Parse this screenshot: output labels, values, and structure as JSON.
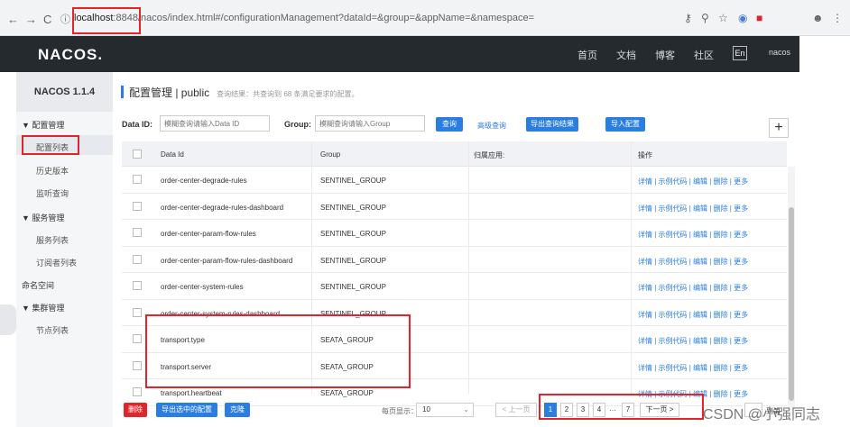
{
  "browser": {
    "back": "←",
    "forward": "→",
    "reload": "C",
    "url_host": "localhost",
    "url_port": ":8848",
    "url_path": "/nacos/index.html#/configurationManagement?dataId=&group=&appName=&namespace="
  },
  "header": {
    "logo": "NACOS.",
    "menu": [
      "首页",
      "文档",
      "博客",
      "社区"
    ],
    "lang": "En",
    "user": "nacos"
  },
  "sidebar": {
    "version": "NACOS 1.1.4",
    "groups": [
      {
        "label": "▼ 配置管理",
        "items": [
          "配置列表",
          "历史版本",
          "监听查询"
        ]
      },
      {
        "label": "▼ 服务管理",
        "items": [
          "服务列表",
          "订阅者列表"
        ]
      },
      {
        "label": "命名空间",
        "items": []
      },
      {
        "label": "▼ 集群管理",
        "items": [
          "节点列表"
        ]
      }
    ]
  },
  "main": {
    "breadcrumb": "配置管理 | public",
    "subtitle": "查询结果：共查询到 68 条满足要求的配置。",
    "filter": {
      "dataid_label": "Data ID:",
      "dataid_placeholder": "模糊查询请输入Data ID",
      "group_label": "Group:",
      "group_placeholder": "模糊查询请输入Group",
      "query": "查询",
      "advanced": "高级查询",
      "export_query": "导出查询结果",
      "import": "导入配置",
      "add": "+"
    },
    "table": {
      "headers": [
        "Data Id",
        "Group",
        "归属应用:",
        "操作"
      ],
      "ops": "详情 | 示例代码 | 编辑 | 删除 | 更多",
      "rows": [
        {
          "dataid": "order-center-degrade-rules",
          "group": "SENTINEL_GROUP"
        },
        {
          "dataid": "order-center-degrade-rules-dashboard",
          "group": "SENTINEL_GROUP"
        },
        {
          "dataid": "order-center-param-flow-rules",
          "group": "SENTINEL_GROUP"
        },
        {
          "dataid": "order-center-param-flow-rules-dashboard",
          "group": "SENTINEL_GROUP"
        },
        {
          "dataid": "order-center-system-rules",
          "group": "SENTINEL_GROUP"
        },
        {
          "dataid": "order-center-system-rules-dashboard",
          "group": "SENTINEL_GROUP"
        },
        {
          "dataid": "transport.type",
          "group": "SEATA_GROUP"
        },
        {
          "dataid": "transport.server",
          "group": "SEATA_GROUP"
        },
        {
          "dataid": "transport.heartbeat",
          "group": "SEATA_GROUP"
        }
      ]
    },
    "footer": {
      "delete": "删除",
      "export_selected": "导出选中的配置",
      "clone": "克隆",
      "page_size_label": "每页显示：",
      "page_size": "10",
      "prev": "< 上一页",
      "pages": [
        "1",
        "2",
        "3",
        "4",
        "···",
        "7"
      ],
      "next": "下一页 >",
      "goto": "到第"
    }
  },
  "watermark": "CSDN @小强同志",
  "colors": {
    "accent": "#2a7de1",
    "header": "#252a2f",
    "highlight": "#e0262c",
    "danger": "#e0262c"
  }
}
